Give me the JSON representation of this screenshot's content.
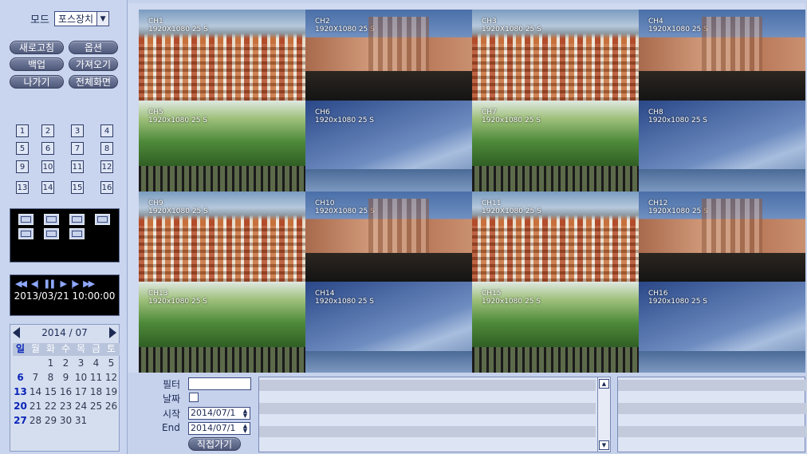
{
  "sidebar": {
    "mode_label": "모드",
    "mode_value": "포스장치",
    "buttons": {
      "refresh": "새로고침",
      "options": "옵션",
      "backup": "백업",
      "import": "가져오기",
      "exit": "나가기",
      "fullscreen": "전체화면"
    },
    "channels": [
      "1",
      "2",
      "3",
      "4",
      "5",
      "6",
      "7",
      "8",
      "9",
      "10",
      "11",
      "12",
      "13",
      "14",
      "15",
      "16"
    ],
    "layout_icons": [
      "layout-1x1-icon",
      "layout-2x2-icon",
      "layout-1p5-icon",
      "layout-1p7-icon",
      "layout-3x3-icon",
      "layout-2p8-icon",
      "layout-4x4-icon"
    ],
    "playback": {
      "controls": [
        "rewind-icon",
        "step-back-icon",
        "pause-icon",
        "play-icon",
        "step-forward-icon",
        "fast-forward-icon"
      ],
      "time": "2013/03/21 10:00:00"
    },
    "calendar": {
      "title": "2014 / 07",
      "weekdays": [
        "일",
        "월",
        "화",
        "수",
        "목",
        "금",
        "토"
      ],
      "weeks": [
        [
          "",
          "",
          "1",
          "2",
          "3",
          "4",
          "5"
        ],
        [
          "6",
          "7",
          "8",
          "9",
          "10",
          "11",
          "12"
        ],
        [
          "13",
          "14",
          "15",
          "16",
          "17",
          "18",
          "19"
        ],
        [
          "20",
          "21",
          "22",
          "23",
          "24",
          "25",
          "26"
        ],
        [
          "27",
          "28",
          "29",
          "30",
          "31",
          "",
          ""
        ]
      ]
    }
  },
  "channels": [
    {
      "name": "CH1",
      "res": "1920X1080 25 S",
      "scene": "city"
    },
    {
      "name": "CH2",
      "res": "1920X1080 25 S",
      "scene": "church"
    },
    {
      "name": "CH3",
      "res": "1920X1080 25 S",
      "scene": "city"
    },
    {
      "name": "CH4",
      "res": "1920X1080 25 S",
      "scene": "church"
    },
    {
      "name": "CH5",
      "res": "1920x1080 25 S",
      "scene": "trees"
    },
    {
      "name": "CH6",
      "res": "1920x1080 25 S",
      "scene": "sky"
    },
    {
      "name": "CH7",
      "res": "1920x1080 25 S",
      "scene": "trees"
    },
    {
      "name": "CH8",
      "res": "1920x1080 25 S",
      "scene": "sky"
    },
    {
      "name": "CH9",
      "res": "1920X1080 25 S",
      "scene": "city"
    },
    {
      "name": "CH10",
      "res": "1920X1080 25 S",
      "scene": "church"
    },
    {
      "name": "CH11",
      "res": "1920X1080 25 S",
      "scene": "city"
    },
    {
      "name": "CH12",
      "res": "1920X1080 25 S",
      "scene": "church"
    },
    {
      "name": "CH13",
      "res": "1920x1080 25 S",
      "scene": "trees"
    },
    {
      "name": "CH14",
      "res": "1920x1080 25 S",
      "scene": "sky"
    },
    {
      "name": "CH15",
      "res": "1920x1080 25 S",
      "scene": "trees"
    },
    {
      "name": "CH16",
      "res": "1920x1080 25 S",
      "scene": "sky"
    }
  ],
  "search": {
    "filter_label": "필터",
    "filter_value": "",
    "date_label": "날짜",
    "date_checked": false,
    "start_label": "시작",
    "start_value": "2014/07/1",
    "end_label": "End",
    "end_value": "2014/07/1",
    "goto_button": "직접가기"
  }
}
